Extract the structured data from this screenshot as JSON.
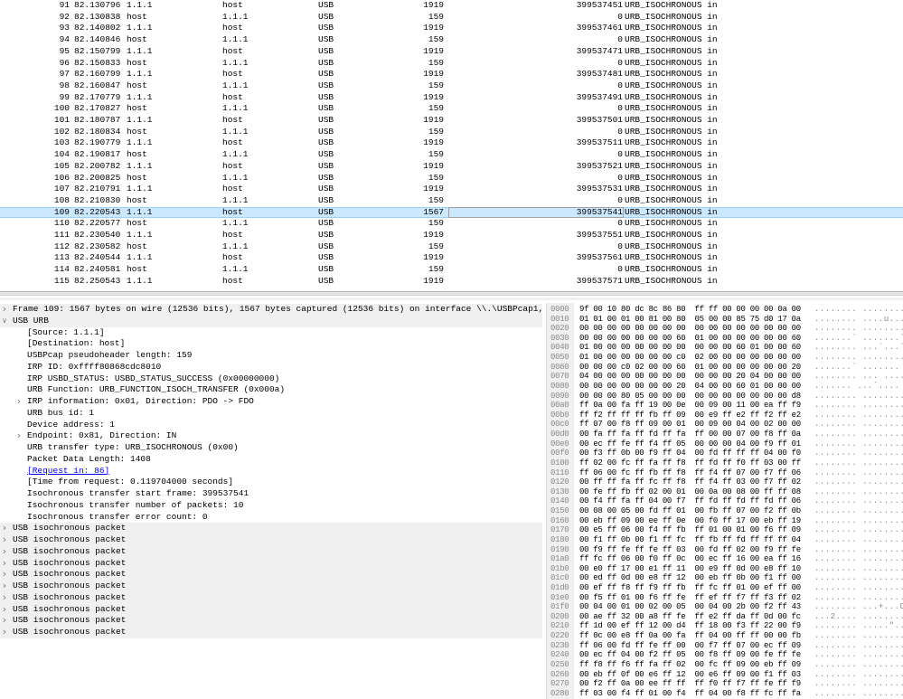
{
  "packet_list": {
    "selected_no": "109",
    "rows": [
      [
        "91",
        "82.130796",
        "1.1.1",
        "host",
        "USB",
        "1919",
        "399537451",
        "URB_ISOCHRONOUS in"
      ],
      [
        "92",
        "82.130838",
        "host",
        "1.1.1",
        "USB",
        "159",
        "0",
        "URB_ISOCHRONOUS in"
      ],
      [
        "93",
        "82.140802",
        "1.1.1",
        "host",
        "USB",
        "1919",
        "399537461",
        "URB_ISOCHRONOUS in"
      ],
      [
        "94",
        "82.140846",
        "host",
        "1.1.1",
        "USB",
        "159",
        "0",
        "URB_ISOCHRONOUS in"
      ],
      [
        "95",
        "82.150799",
        "1.1.1",
        "host",
        "USB",
        "1919",
        "399537471",
        "URB_ISOCHRONOUS in"
      ],
      [
        "96",
        "82.150833",
        "host",
        "1.1.1",
        "USB",
        "159",
        "0",
        "URB_ISOCHRONOUS in"
      ],
      [
        "97",
        "82.160799",
        "1.1.1",
        "host",
        "USB",
        "1919",
        "399537481",
        "URB_ISOCHRONOUS in"
      ],
      [
        "98",
        "82.160847",
        "host",
        "1.1.1",
        "USB",
        "159",
        "0",
        "URB_ISOCHRONOUS in"
      ],
      [
        "99",
        "82.170779",
        "1.1.1",
        "host",
        "USB",
        "1919",
        "399537491",
        "URB_ISOCHRONOUS in"
      ],
      [
        "100",
        "82.170827",
        "host",
        "1.1.1",
        "USB",
        "159",
        "0",
        "URB_ISOCHRONOUS in"
      ],
      [
        "101",
        "82.180787",
        "1.1.1",
        "host",
        "USB",
        "1919",
        "399537501",
        "URB_ISOCHRONOUS in"
      ],
      [
        "102",
        "82.180834",
        "host",
        "1.1.1",
        "USB",
        "159",
        "0",
        "URB_ISOCHRONOUS in"
      ],
      [
        "103",
        "82.190779",
        "1.1.1",
        "host",
        "USB",
        "1919",
        "399537511",
        "URB_ISOCHRONOUS in"
      ],
      [
        "104",
        "82.190817",
        "host",
        "1.1.1",
        "USB",
        "159",
        "0",
        "URB_ISOCHRONOUS in"
      ],
      [
        "105",
        "82.200782",
        "1.1.1",
        "host",
        "USB",
        "1919",
        "399537521",
        "URB_ISOCHRONOUS in"
      ],
      [
        "106",
        "82.200825",
        "host",
        "1.1.1",
        "USB",
        "159",
        "0",
        "URB_ISOCHRONOUS in"
      ],
      [
        "107",
        "82.210791",
        "1.1.1",
        "host",
        "USB",
        "1919",
        "399537531",
        "URB_ISOCHRONOUS in"
      ],
      [
        "108",
        "82.210830",
        "host",
        "1.1.1",
        "USB",
        "159",
        "0",
        "URB_ISOCHRONOUS in"
      ],
      [
        "109",
        "82.220543",
        "1.1.1",
        "host",
        "USB",
        "1567",
        "399537541",
        "URB_ISOCHRONOUS in"
      ],
      [
        "110",
        "82.220577",
        "host",
        "1.1.1",
        "USB",
        "159",
        "0",
        "URB_ISOCHRONOUS in"
      ],
      [
        "111",
        "82.230540",
        "1.1.1",
        "host",
        "USB",
        "1919",
        "399537551",
        "URB_ISOCHRONOUS in"
      ],
      [
        "112",
        "82.230582",
        "host",
        "1.1.1",
        "USB",
        "159",
        "0",
        "URB_ISOCHRONOUS in"
      ],
      [
        "113",
        "82.240544",
        "1.1.1",
        "host",
        "USB",
        "1919",
        "399537561",
        "URB_ISOCHRONOUS in"
      ],
      [
        "114",
        "82.240581",
        "host",
        "1.1.1",
        "USB",
        "159",
        "0",
        "URB_ISOCHRONOUS in"
      ],
      [
        "115",
        "82.250543",
        "1.1.1",
        "host",
        "USB",
        "1919",
        "399537571",
        "URB_ISOCHRONOUS in"
      ]
    ]
  },
  "details": [
    {
      "level": 0,
      "exp": "collapsed",
      "top": true,
      "text": "Frame 109: 1567 bytes on wire (12536 bits), 1567 bytes captured (12536 bits) on interface \\\\.\\USBPcap1, id 0"
    },
    {
      "level": 0,
      "exp": "expanded",
      "top": true,
      "text": "USB URB"
    },
    {
      "level": 1,
      "text": "[Source: 1.1.1]"
    },
    {
      "level": 1,
      "text": "[Destination: host]"
    },
    {
      "level": 1,
      "text": "USBPcap pseudoheader length: 159"
    },
    {
      "level": 1,
      "text": "IRP ID: 0xffff80868cdc8010"
    },
    {
      "level": 1,
      "text": "IRP USBD_STATUS: USBD_STATUS_SUCCESS (0x00000000)"
    },
    {
      "level": 1,
      "text": "URB Function: URB_FUNCTION_ISOCH_TRANSFER (0x000a)"
    },
    {
      "level": 1,
      "exp": "collapsed",
      "text": "IRP information: 0x01, Direction: PDO -> FDO"
    },
    {
      "level": 1,
      "text": "URB bus id: 1"
    },
    {
      "level": 1,
      "text": "Device address: 1"
    },
    {
      "level": 1,
      "exp": "collapsed",
      "text": "Endpoint: 0x81, Direction: IN"
    },
    {
      "level": 1,
      "text": "URB transfer type: URB_ISOCHRONOUS (0x00)"
    },
    {
      "level": 1,
      "text": "Packet Data Length: 1408"
    },
    {
      "level": 1,
      "link": true,
      "text": "[Request in: 86]"
    },
    {
      "level": 1,
      "text": "[Time from request: 0.119704000 seconds]"
    },
    {
      "level": 1,
      "text": "Isochronous transfer start frame: 399537541"
    },
    {
      "level": 1,
      "text": "Isochronous transfer number of packets: 10"
    },
    {
      "level": 1,
      "text": "Isochronous transfer error count: 0"
    },
    {
      "level": 0,
      "exp": "collapsed",
      "top": true,
      "text": "USB isochronous packet"
    },
    {
      "level": 0,
      "exp": "collapsed",
      "top": true,
      "text": "USB isochronous packet"
    },
    {
      "level": 0,
      "exp": "collapsed",
      "top": true,
      "text": "USB isochronous packet"
    },
    {
      "level": 0,
      "exp": "collapsed",
      "top": true,
      "text": "USB isochronous packet"
    },
    {
      "level": 0,
      "exp": "collapsed",
      "top": true,
      "text": "USB isochronous packet"
    },
    {
      "level": 0,
      "exp": "collapsed",
      "top": true,
      "text": "USB isochronous packet"
    },
    {
      "level": 0,
      "exp": "collapsed",
      "top": true,
      "text": "USB isochronous packet"
    },
    {
      "level": 0,
      "exp": "collapsed",
      "top": true,
      "text": "USB isochronous packet"
    },
    {
      "level": 0,
      "exp": "collapsed",
      "top": true,
      "text": "USB isochronous packet"
    },
    {
      "level": 0,
      "exp": "collapsed",
      "top": true,
      "text": "USB isochronous packet"
    }
  ],
  "hex": [
    [
      "0000",
      "9f 00 10 80 dc 8c 86 80  ff ff 00 00 00 00 0a 00",
      "........ ........"
    ],
    [
      "0010",
      "01 01 00 01 00 81 00 80  05 00 00 85 75 d0 17 0a",
      "........ ....u..."
    ],
    [
      "0020",
      "00 00 00 00 00 00 00 00  00 00 00 00 00 00 00 00",
      "........ ........"
    ],
    [
      "0030",
      "00 00 00 00 00 00 00 60  01 00 00 00 00 00 00 60",
      ".......` .......`"
    ],
    [
      "0040",
      "01 00 00 00 00 00 00 00  00 00 00 60 01 00 00 60",
      "........ ...`...`"
    ],
    [
      "0050",
      "01 00 00 00 00 00 00 c0  02 00 00 00 00 00 00 00",
      "........ ........"
    ],
    [
      "0060",
      "00 00 00 c0 02 00 00 60  01 00 00 00 00 00 00 20",
      ".......` ....... "
    ],
    [
      "0070",
      "04 00 00 00 00 00 00 00  00 00 00 20 04 00 00 00",
      "........ ... ...."
    ],
    [
      "0080",
      "00 00 00 00 00 00 00 20  04 00 00 60 01 00 00 00",
      "....... ...`...."
    ],
    [
      "0090",
      "00 00 00 80 05 00 00 00  00 00 00 00 00 00 00 d8",
      "........ ........"
    ],
    [
      "00a0",
      "ff 0a 00 fa ff 19 00 0e  00 09 00 11 00 ea ff f9",
      "........ ........"
    ],
    [
      "00b0",
      "ff f2 ff ff ff fb ff 09  00 e9 ff e2 ff f2 ff e2",
      "........ ........"
    ],
    [
      "00c0",
      "ff 07 00 f8 ff 09 00 01  00 09 00 04 00 02 00 00",
      "........ ........"
    ],
    [
      "00d0",
      "00 fa ff fa ff fd ff fa  ff 00 00 07 00 f8 ff 0a",
      "........ ........"
    ],
    [
      "00e0",
      "00 ec ff fe ff f4 ff 05  00 00 00 04 00 f9 ff 01",
      "........ ........"
    ],
    [
      "00f0",
      "00 f3 ff 0b 00 f9 ff 04  00 fd ff ff ff 04 00 f0",
      "........ ........"
    ],
    [
      "0100",
      "ff 02 00 fc ff fa ff f8  ff fd ff f0 ff 03 00 ff",
      "........ ........"
    ],
    [
      "0110",
      "ff 06 00 fc ff fb ff f8  ff f4 ff 07 00 f7 ff 06",
      "........ ........"
    ],
    [
      "0120",
      "00 ff ff fa ff fc ff f8  ff f4 ff 03 00 f7 ff 02",
      "........ ........"
    ],
    [
      "0130",
      "00 fe ff fb ff 02 00 01  00 0a 00 08 00 ff ff 08",
      "........ ........"
    ],
    [
      "0140",
      "00 f4 ff fa ff 04 00 f7  ff fd ff fd ff fd ff 06",
      "........ ........"
    ],
    [
      "0150",
      "00 08 00 05 00 fd ff 01  00 fb ff 07 00 f2 ff 0b",
      "........ ........"
    ],
    [
      "0160",
      "00 eb ff 09 00 ee ff 0e  00 f0 ff 17 00 eb ff 19",
      "........ ........"
    ],
    [
      "0170",
      "00 e5 ff 06 00 f4 ff fb  ff 01 00 01 00 f6 ff 09",
      "........ ........"
    ],
    [
      "0180",
      "00 f1 ff 0b 00 f1 ff fc  ff fb ff fd ff ff ff 04",
      "........ ........"
    ],
    [
      "0190",
      "00 f9 ff fe ff fe ff 03  00 fd ff 02 00 f9 ff fe",
      "........ ........"
    ],
    [
      "01a0",
      "ff fc ff 06 00 f0 ff 0c  00 ec ff 16 00 ea ff 16",
      "........ ........"
    ],
    [
      "01b0",
      "00 e0 ff 17 00 e1 ff 11  00 e9 ff 0d 00 e8 ff 10",
      "........ ........"
    ],
    [
      "01c0",
      "00 ed ff 0d 00 e8 ff 12  00 eb ff 0b 00 f1 ff 00",
      "........ ........"
    ],
    [
      "01d0",
      "00 ef ff f8 ff f9 ff fb  ff fc ff 01 00 ef ff 00",
      "........ ........"
    ],
    [
      "01e0",
      "00 f5 ff 01 00 f6 ff fe  ff ef ff f7 ff f3 ff 02",
      "........ ........"
    ],
    [
      "01f0",
      "00 04 00 01 00 02 00 05  00 04 00 2b 00 f2 ff 43",
      "........ ...+...C"
    ],
    [
      "0200",
      "00 ae ff 32 00 a8 ff fe  ff e2 ff da ff 0d 00 fc",
      "...2.... ........"
    ],
    [
      "0210",
      "ff 1d 00 ef ff 12 00 d4  ff 18 00 f3 ff 22 00 f9",
      "........ .....\".."
    ],
    [
      "0220",
      "ff 0c 00 e8 ff 0a 00 fa  ff 04 00 ff ff 00 00 fb",
      "........ ........"
    ],
    [
      "0230",
      "ff 06 00 fd ff fe ff 00  00 f7 ff 07 00 ec ff 09",
      "........ ........"
    ],
    [
      "0240",
      "00 ec ff 04 00 f2 ff 05  00 f8 ff 09 00 fe ff fe",
      "........ ........"
    ],
    [
      "0250",
      "ff f8 ff f6 ff fa ff 02  00 fc ff 09 00 eb ff 09",
      "........ ........"
    ],
    [
      "0260",
      "00 eb ff 0f 00 e6 ff 12  00 e6 ff 09 00 f1 ff 03",
      "........ ........"
    ],
    [
      "0270",
      "00 f2 ff 0a 00 ee ff ff  ff f0 ff f7 ff fe ff f9",
      "........ ........"
    ],
    [
      "0280",
      "ff 03 00 f4 ff 01 00 f4  ff 04 00 f8 ff fc ff fa",
      "........ ........"
    ]
  ],
  "colors": {
    "selection": "#cce8ff",
    "link": "#0000ee",
    "offset": "#8a8a8a"
  }
}
